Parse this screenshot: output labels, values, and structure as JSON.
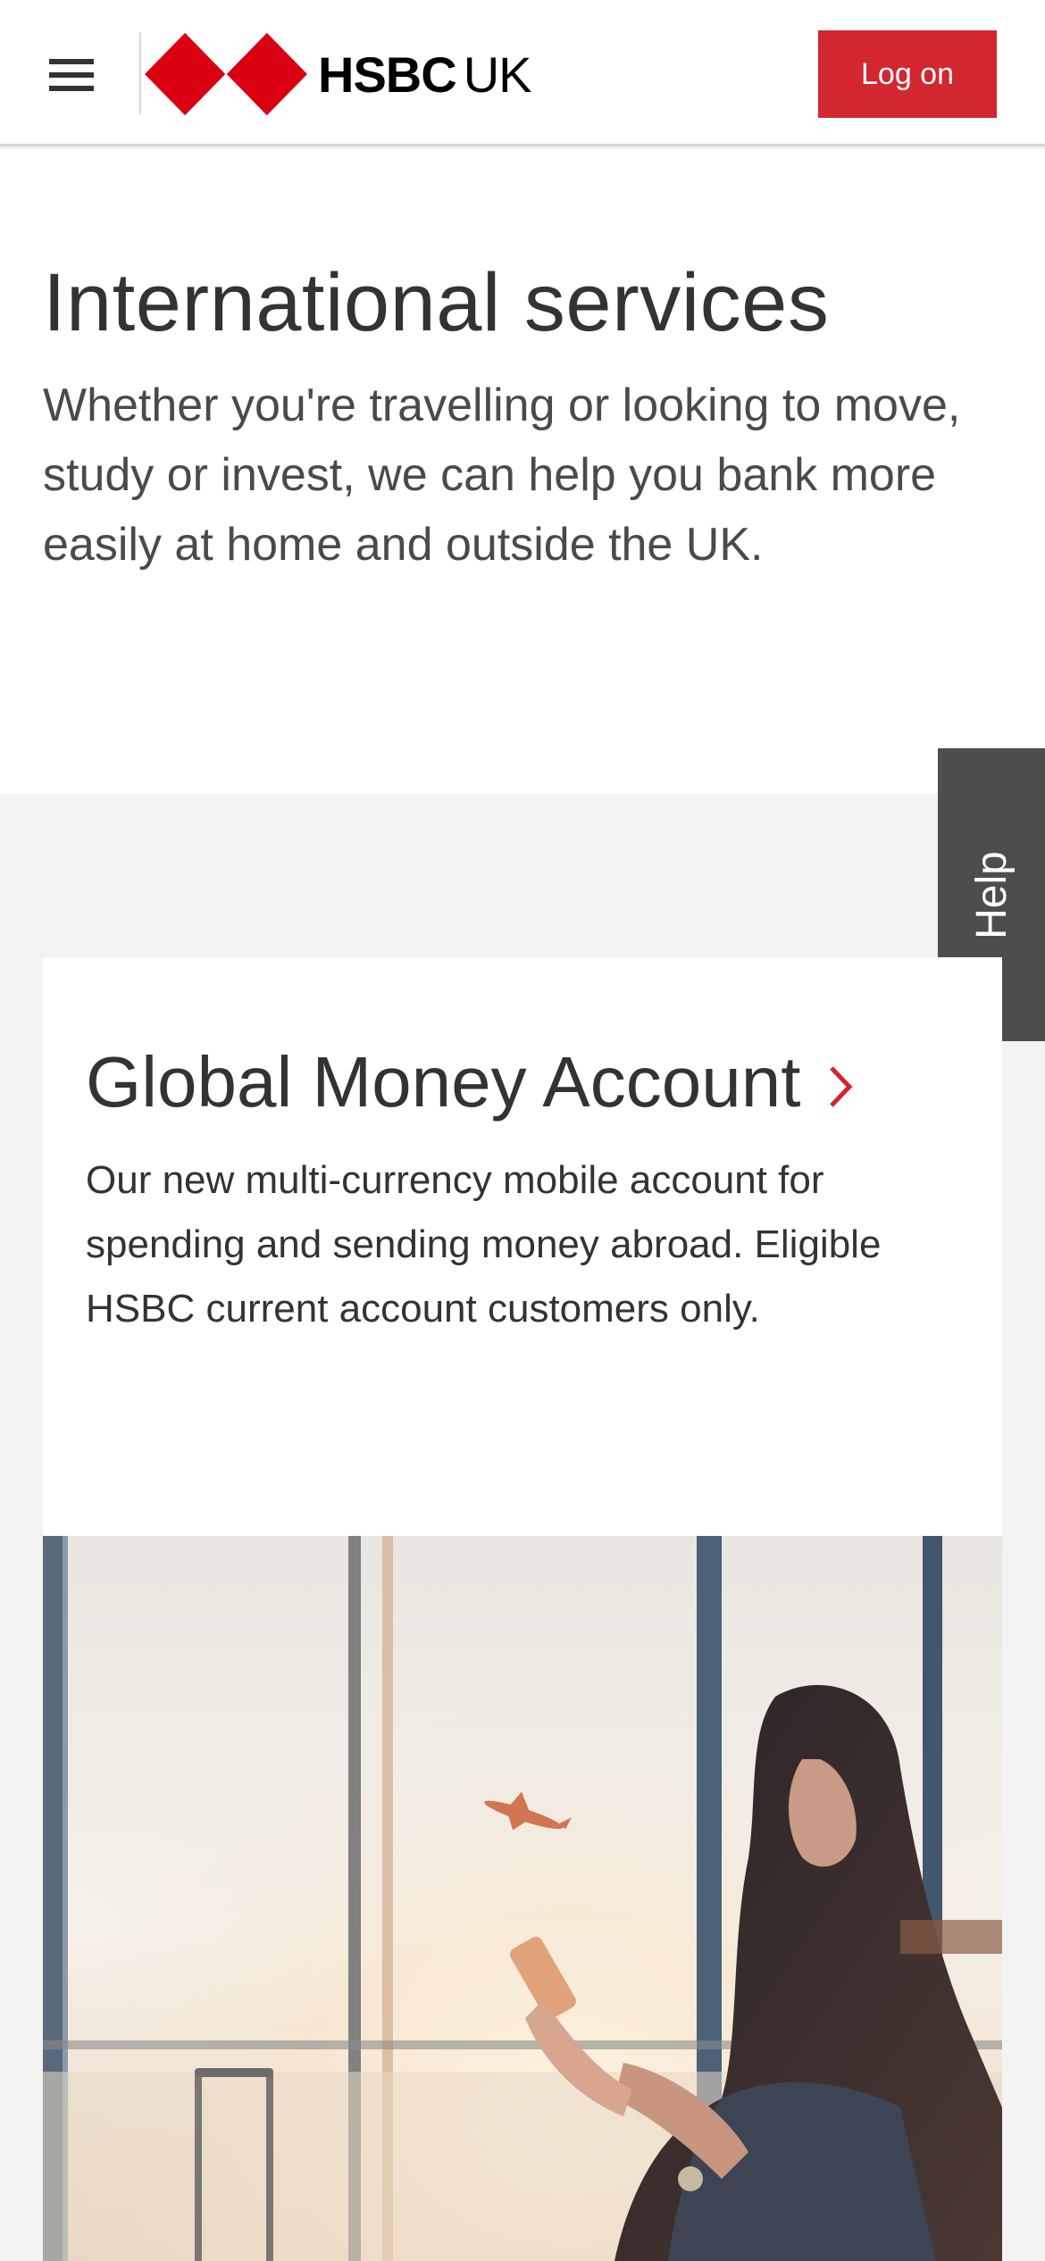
{
  "header": {
    "menu_icon": "hamburger-menu-icon",
    "logo_icon": "hsbc-hexagon-logo-icon",
    "brand": "HSBC",
    "region": "UK",
    "logon_label": "Log on",
    "brand_color": "#d22630"
  },
  "hero": {
    "title": "International services",
    "description": "Whether you're travelling or looking to move, study or invest, we can help you bank more easily at home and outside the UK."
  },
  "help_tab": {
    "label": "Help"
  },
  "card": {
    "title": "Global Money Account",
    "chevron_icon": "chevron-right-icon",
    "description": "Our new multi-currency mobile account for spending and sending money abroad. Eligible HSBC current account customers only.",
    "image_icon": "traveller-at-airport-photo"
  }
}
